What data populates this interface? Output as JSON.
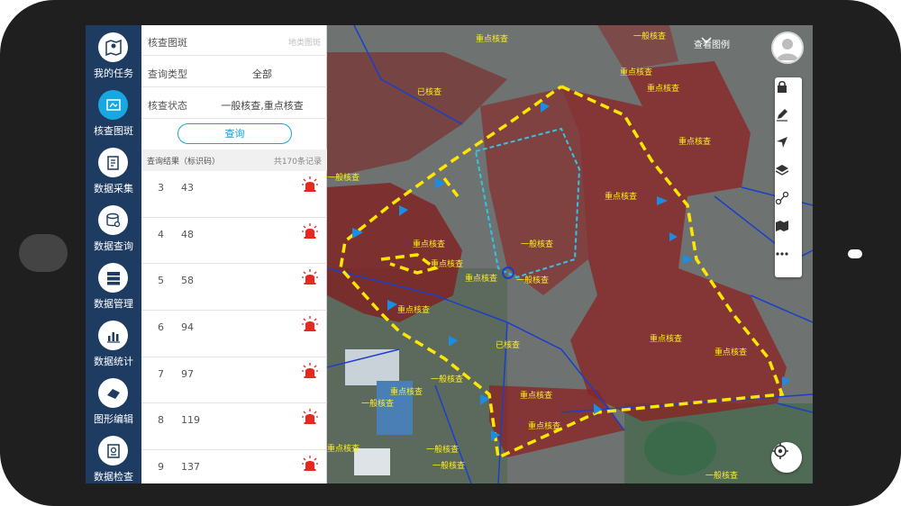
{
  "nav": {
    "items": [
      {
        "label": "我的任务",
        "icon": "map-pin-icon"
      },
      {
        "label": "核查图斑",
        "icon": "map-layers-icon"
      },
      {
        "label": "数据采集",
        "icon": "edit-document-icon"
      },
      {
        "label": "数据查询",
        "icon": "database-search-icon"
      },
      {
        "label": "数据管理",
        "icon": "server-icon"
      },
      {
        "label": "数据统计",
        "icon": "bar-chart-icon"
      },
      {
        "label": "图形编辑",
        "icon": "shape-edit-icon"
      },
      {
        "label": "数据检查",
        "icon": "document-check-icon"
      }
    ]
  },
  "panel": {
    "title": "核查图斑",
    "title_hint": "地类图斑",
    "query_type_label": "查询类型",
    "query_type_value": "全部",
    "check_status_label": "核查状态",
    "check_status_value": "一般核查,重点核查",
    "query_button": "查询",
    "result_label": "查询结果（标识码）",
    "result_count": "共170条记录",
    "results": [
      {
        "index": "3",
        "code": "43"
      },
      {
        "index": "4",
        "code": "48"
      },
      {
        "index": "5",
        "code": "58"
      },
      {
        "index": "6",
        "code": "94"
      },
      {
        "index": "7",
        "code": "97"
      },
      {
        "index": "8",
        "code": "119"
      },
      {
        "index": "9",
        "code": "137"
      }
    ]
  },
  "map": {
    "legend_button": "查看图例",
    "labels": [
      "重点核查",
      "一般核查",
      "重点核查",
      "已核查",
      "重点核查",
      "重点核查",
      "重点核查",
      "一般核查",
      "重点核查",
      "重点核查",
      "重点核查",
      "一般核查",
      "重点核查",
      "重点核查",
      "已核查",
      "一般核查",
      "一般核查",
      "重点核查",
      "重点核查",
      "一般核查",
      "重点核查",
      "重点核查",
      "一般核查",
      "一般核查",
      "重点核查",
      "一般核查"
    ],
    "tools": [
      "lock-icon",
      "pen-icon",
      "navigate-icon",
      "layers-icon",
      "measure-icon",
      "map-icon",
      "more-icon"
    ],
    "colors": {
      "check_area": "#8b2222",
      "route": "#ffe600",
      "boundary": "#1a3fc8",
      "general_area": "#36c2e0"
    }
  }
}
